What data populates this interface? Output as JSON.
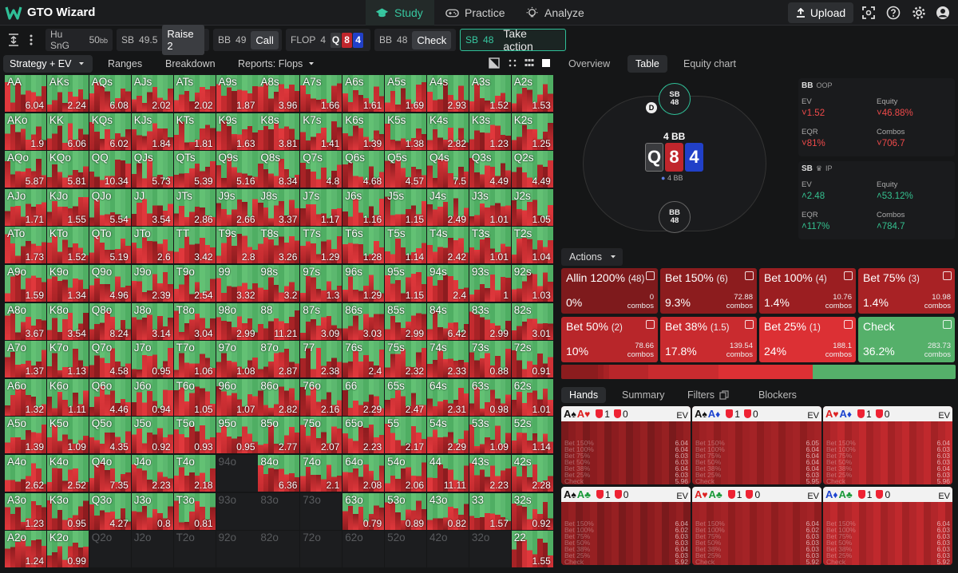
{
  "app": {
    "name": "GTO Wizard",
    "brand_color": "#2fbf97"
  },
  "nav": {
    "tabs": [
      {
        "label": "Study",
        "icon": "graduation-cap-icon"
      },
      {
        "label": "Practice",
        "icon": "gamepad-icon"
      },
      {
        "label": "Analyze",
        "icon": "lightbulb-icon"
      }
    ],
    "active": "Study"
  },
  "topbar": {
    "upload_label": "Upload"
  },
  "line": {
    "game": {
      "name": "Hu SnG",
      "depth": "50",
      "unit": "bb"
    },
    "steps": [
      {
        "pos": "SB",
        "stack": "49.5",
        "action": "Raise 2"
      },
      {
        "pos": "BB",
        "stack": "49",
        "action": "Call"
      },
      {
        "pos": "FLOP",
        "stack": "4",
        "cards": [
          "Q",
          "8",
          "4"
        ]
      },
      {
        "pos": "BB",
        "stack": "48",
        "action": "Check"
      },
      {
        "pos": "SB",
        "stack": "48",
        "action": "Take action"
      }
    ]
  },
  "left_tabs": {
    "strategy": "Strategy + EV",
    "ranges": "Ranges",
    "breakdown": "Breakdown",
    "reports": "Reports: Flops"
  },
  "right_tabs": {
    "overview": "Overview",
    "table": "Table",
    "equity": "Equity chart"
  },
  "table": {
    "pot": "4 BB",
    "board": [
      {
        "rank": "Q",
        "color": "#3a3b3e"
      },
      {
        "rank": "8",
        "color": "#c0262c"
      },
      {
        "rank": "4",
        "color": "#2140c8"
      }
    ],
    "chips_label": "4 BB",
    "seats": [
      {
        "pos": "SB",
        "stack": "48"
      },
      {
        "pos": "BB",
        "stack": "48"
      }
    ],
    "dealer": "D"
  },
  "players": [
    {
      "pos": "BB",
      "tag": "OOP",
      "ev_label": "EV",
      "ev": "1.52",
      "equity_label": "Equity",
      "equity": "46.88%",
      "eqr_label": "EQR",
      "eqr": "81%",
      "combos_label": "Combos",
      "combos": "706.7",
      "sign": "neg"
    },
    {
      "pos": "SB",
      "tag": "IP",
      "ev_label": "EV",
      "ev": "2.48",
      "equity_label": "Equity",
      "equity": "53.12%",
      "eqr_label": "EQR",
      "eqr": "117%",
      "combos_label": "Combos",
      "combos": "784.7",
      "sign": "pos"
    }
  ],
  "actions_label": "Actions",
  "actions": [
    {
      "name": "Allin 1200%",
      "size": "(48)",
      "pct": "0%",
      "combos": "0",
      "color": "#7e1a1c"
    },
    {
      "name": "Bet 150%",
      "size": "(6)",
      "pct": "9.3%",
      "combos": "72.88",
      "color": "#8c1c1e"
    },
    {
      "name": "Bet 100%",
      "size": "(4)",
      "pct": "1.4%",
      "combos": "10.76",
      "color": "#9b1e21"
    },
    {
      "name": "Bet 75%",
      "size": "(3)",
      "pct": "1.4%",
      "combos": "10.98",
      "color": "#a82225"
    },
    {
      "name": "Bet 50%",
      "size": "(2)",
      "pct": "10%",
      "combos": "78.66",
      "color": "#b8262a"
    },
    {
      "name": "Bet 38%",
      "size": "(1.5)",
      "pct": "17.8%",
      "combos": "139.54",
      "color": "#c92b2f"
    },
    {
      "name": "Bet 25%",
      "size": "(1)",
      "pct": "24%",
      "combos": "188.1",
      "color": "#dc3034"
    },
    {
      "name": "Check",
      "size": "",
      "pct": "36.2%",
      "combos": "283.73",
      "color": "#55b06a"
    }
  ],
  "combos_word": "combos",
  "hand_tabs": {
    "hands": "Hands",
    "summary": "Summary",
    "filters": "Filters",
    "blockers": "Blockers"
  },
  "hand_cards": [
    {
      "cards": [
        [
          "A",
          "spade"
        ],
        [
          "A",
          "heart"
        ]
      ],
      "b1": "1",
      "b2": "0",
      "ev_label": "EV",
      "vals": [
        "6.04",
        "6.04",
        "6.03",
        "6.03",
        "6.04",
        "6.03",
        "5.96"
      ]
    },
    {
      "cards": [
        [
          "A",
          "spade"
        ],
        [
          "A",
          "diamond"
        ]
      ],
      "b1": "1",
      "b2": "0",
      "ev_label": "EV",
      "vals": [
        "6.05",
        "6.04",
        "6.04",
        "6.04",
        "6.04",
        "6.03",
        "5.95"
      ]
    },
    {
      "cards": [
        [
          "A",
          "heart"
        ],
        [
          "A",
          "diamond"
        ]
      ],
      "b1": "1",
      "b2": "0",
      "ev_label": "EV",
      "vals": [
        "6.04",
        "6.03",
        "6.03",
        "6.03",
        "6.04",
        "6.03",
        "5.96"
      ]
    },
    {
      "cards": [
        [
          "A",
          "spade"
        ],
        [
          "A",
          "club"
        ]
      ],
      "b1": "1",
      "b2": "0",
      "ev_label": "EV",
      "vals": [
        "6.04",
        "6.02",
        "6.03",
        "6.03",
        "6.04",
        "6.03",
        "5.92"
      ]
    },
    {
      "cards": [
        [
          "A",
          "heart"
        ],
        [
          "A",
          "club"
        ]
      ],
      "b1": "1",
      "b2": "0",
      "ev_label": "EV",
      "vals": [
        "6.04",
        "6.02",
        "6.03",
        "6.03",
        "6.03",
        "6.03",
        "5.92"
      ]
    },
    {
      "cards": [
        [
          "A",
          "diamond"
        ],
        [
          "A",
          "club"
        ]
      ],
      "b1": "1",
      "b2": "0",
      "ev_label": "EV",
      "vals": [
        "6.04",
        "6.03",
        "6.03",
        "6.03",
        "6.03",
        "6.03",
        "5.92"
      ]
    }
  ],
  "hand_rows": [
    "Bet 150%",
    "Bet 100%",
    "Bet 75%",
    "Bet 50%",
    "Bet 38%",
    "Bet 25%",
    "Check"
  ],
  "matrix": {
    "ranks": [
      "A",
      "K",
      "Q",
      "J",
      "T",
      "9",
      "8",
      "7",
      "6",
      "5",
      "4",
      "3",
      "2"
    ],
    "ev": [
      [
        "6.04",
        "2.24",
        "6.08",
        "2.02",
        "2.02",
        "1.87",
        "3.96",
        "1.66",
        "1.61",
        "1.69",
        "2.93",
        "1.52",
        "1.53"
      ],
      [
        "1.9",
        "6.06",
        "6.02",
        "1.84",
        "1.81",
        "1.63",
        "3.81",
        "1.41",
        "1.39",
        "1.38",
        "2.82",
        "1.23",
        "1.25"
      ],
      [
        "5.87",
        "5.81",
        "10.34",
        "5.73",
        "5.39",
        "5.16",
        "8.34",
        "4.8",
        "4.68",
        "4.57",
        "7.5",
        "4.49",
        "4.49"
      ],
      [
        "1.71",
        "1.55",
        "5.54",
        "3.54",
        "2.86",
        "2.66",
        "3.37",
        "1.17",
        "1.16",
        "1.15",
        "2.49",
        "1.01",
        "1.05"
      ],
      [
        "1.73",
        "1.52",
        "5.19",
        "2.6",
        "3.42",
        "2.8",
        "3.26",
        "1.29",
        "1.28",
        "1.14",
        "2.42",
        "1.01",
        "1.04"
      ],
      [
        "1.59",
        "1.34",
        "4.96",
        "2.39",
        "2.54",
        "3.32",
        "3.2",
        "1.3",
        "1.29",
        "1.15",
        "2.4",
        "1",
        "1.03"
      ],
      [
        "3.67",
        "3.54",
        "8.24",
        "3.14",
        "3.04",
        "2.99",
        "11.21",
        "3.09",
        "3.03",
        "2.99",
        "6.42",
        "2.99",
        "3.01"
      ],
      [
        "1.37",
        "1.13",
        "4.58",
        "0.95",
        "1.06",
        "1.08",
        "2.87",
        "2.38",
        "2.4",
        "2.32",
        "2.33",
        "0.88",
        "0.91"
      ],
      [
        "1.32",
        "1.11",
        "4.46",
        "0.94",
        "1.05",
        "1.07",
        "2.82",
        "2.16",
        "2.29",
        "2.47",
        "2.31",
        "0.98",
        "1.01"
      ],
      [
        "1.39",
        "1.09",
        "4.35",
        "0.92",
        "0.93",
        "0.95",
        "2.77",
        "2.07",
        "2.23",
        "2.17",
        "2.29",
        "1.09",
        "1.14"
      ],
      [
        "2.62",
        "2.52",
        "7.35",
        "2.23",
        "2.18",
        "",
        "6.36",
        "2.1",
        "2.08",
        "2.06",
        "11.11",
        "2.23",
        "2.28"
      ],
      [
        "1.23",
        "0.95",
        "4.27",
        "0.8",
        "0.81",
        "",
        "",
        "",
        "0.79",
        "0.89",
        "0.82",
        "1.57",
        "0.92"
      ],
      [
        "1.24",
        "0.99",
        "",
        "",
        "",
        "",
        "",
        "",
        "",
        "",
        "",
        "",
        "1.55"
      ]
    ]
  }
}
